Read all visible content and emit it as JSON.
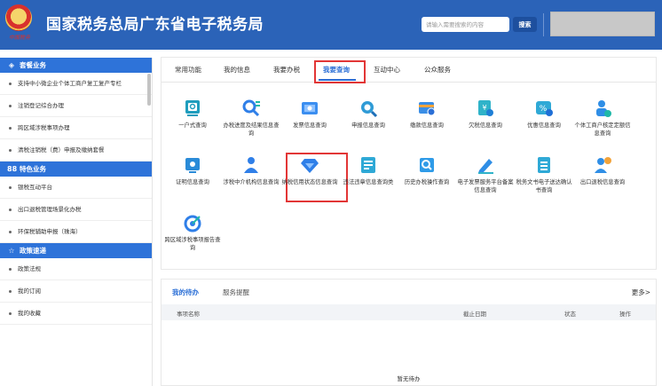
{
  "header": {
    "emblem_text": "中国税务",
    "title": "国家税务总局广东省电子税务局",
    "search_placeholder": "请输入需要搜索的内容",
    "search_button": "搜索"
  },
  "sidebar": {
    "sections": [
      {
        "title": "套餐业务",
        "icon": "layers-icon",
        "items": [
          "支持中小微企业个体工商户复工复产专栏",
          "注销登记综合办理",
          "跨区域涉税事项办理",
          "清税注销税（费）申报及缴纳套餐"
        ]
      },
      {
        "title": "特色业务",
        "icon": "grid-icon",
        "items": [
          "银税互动平台",
          "出口退税管理场景化办税",
          "环保税辅助申报（珠海）"
        ]
      },
      {
        "title": "政策速递",
        "icon": "star-icon",
        "items": [
          "政策法规",
          "我的订阅",
          "我的收藏"
        ]
      }
    ]
  },
  "tabs": [
    "常用功能",
    "我的信息",
    "我要办税",
    "我要查询",
    "互动中心",
    "公众服务"
  ],
  "active_tab": "我要查询",
  "services": [
    {
      "label": "一户式查询",
      "icon": "monitor-search-icon"
    },
    {
      "label": "办税进度及结果信息查询",
      "icon": "progress-search-icon"
    },
    {
      "label": "发票信息查询",
      "icon": "invoice-icon"
    },
    {
      "label": "申报信息查询",
      "icon": "declaration-search-icon"
    },
    {
      "label": "缴款信息查询",
      "icon": "payment-icon"
    },
    {
      "label": "欠税信息查询",
      "icon": "tax-arrears-icon"
    },
    {
      "label": "优惠信息查询",
      "icon": "discount-icon"
    },
    {
      "label": "个体工商户核定定额信息查询",
      "icon": "individual-business-icon"
    },
    {
      "label": "证明信息查询",
      "icon": "certificate-icon"
    },
    {
      "label": "涉税中介机构信息查询",
      "icon": "agency-icon"
    },
    {
      "label": "纳税信用状态信息查询",
      "icon": "credit-diamond-icon"
    },
    {
      "label": "违法违章信息查询类",
      "icon": "violation-icon"
    },
    {
      "label": "历史办税操作查询",
      "icon": "history-search-icon"
    },
    {
      "label": "电子发票服务平台备案信息查询",
      "icon": "e-invoice-icon"
    },
    {
      "label": "税务文书电子送达确认书查询",
      "icon": "document-icon"
    },
    {
      "label": "出口退税信息查询",
      "icon": "export-refund-icon"
    },
    {
      "label": "跨区域涉税事项报告查询",
      "icon": "target-icon"
    }
  ],
  "todo": {
    "tabs": [
      "我的待办",
      "服务提醒"
    ],
    "more": "更多>",
    "columns": [
      "事项名称",
      "截止日期",
      "状态",
      "操作"
    ],
    "empty": "暂无待办"
  },
  "colors": {
    "header": "#2b63b8",
    "accent": "#2b6fd6",
    "highlight_box": "#e23636"
  }
}
